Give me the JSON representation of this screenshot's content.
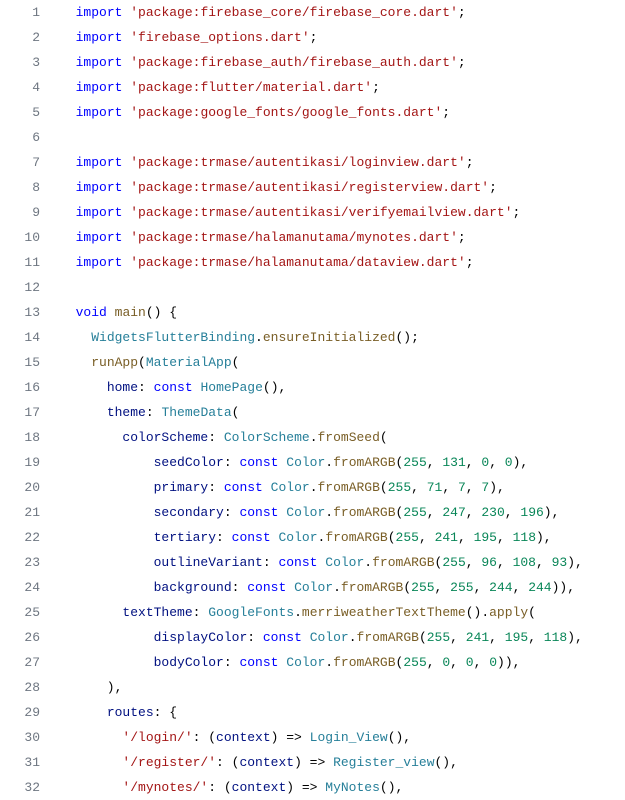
{
  "lines": [
    {
      "n": "1",
      "indent": 1,
      "type": "import",
      "pkg": "'package:firebase_core/firebase_core.dart'"
    },
    {
      "n": "2",
      "indent": 1,
      "type": "import",
      "pkg": "'firebase_options.dart'"
    },
    {
      "n": "3",
      "indent": 1,
      "type": "import",
      "pkg": "'package:firebase_auth/firebase_auth.dart'"
    },
    {
      "n": "4",
      "indent": 1,
      "type": "import",
      "pkg": "'package:flutter/material.dart'"
    },
    {
      "n": "5",
      "indent": 1,
      "type": "import",
      "pkg": "'package:google_fonts/google_fonts.dart'"
    },
    {
      "n": "6",
      "indent": 0,
      "type": "blank"
    },
    {
      "n": "7",
      "indent": 1,
      "type": "import",
      "pkg": "'package:trmase/autentikasi/loginview.dart'"
    },
    {
      "n": "8",
      "indent": 1,
      "type": "import",
      "pkg": "'package:trmase/autentikasi/registerview.dart'"
    },
    {
      "n": "9",
      "indent": 1,
      "type": "import",
      "pkg": "'package:trmase/autentikasi/verifyemailview.dart'"
    },
    {
      "n": "10",
      "indent": 1,
      "type": "import",
      "pkg": "'package:trmase/halamanutama/mynotes.dart'"
    },
    {
      "n": "11",
      "indent": 1,
      "type": "import",
      "pkg": "'package:trmase/halamanutama/dataview.dart'"
    },
    {
      "n": "12",
      "indent": 0,
      "type": "blank"
    },
    {
      "n": "13",
      "indent": 1,
      "type": "raw",
      "html": "<span class=\"kw\">void</span> <span class=\"fn\">main</span>() {"
    },
    {
      "n": "14",
      "indent": 2,
      "type": "raw",
      "html": "<span class=\"cls\">WidgetsFlutterBinding</span>.<span class=\"fn\">ensureInitialized</span>();"
    },
    {
      "n": "15",
      "indent": 2,
      "type": "raw",
      "html": "<span class=\"fn\">runApp</span>(<span class=\"cls\">MaterialApp</span>("
    },
    {
      "n": "16",
      "indent": 3,
      "type": "raw",
      "html": "<span class=\"prop\">home</span>: <span class=\"kw\">const</span> <span class=\"cls\">HomePage</span>(),"
    },
    {
      "n": "17",
      "indent": 3,
      "type": "raw",
      "html": "<span class=\"prop\">theme</span>: <span class=\"cls\">ThemeData</span>("
    },
    {
      "n": "18",
      "indent": 4,
      "type": "raw",
      "html": "<span class=\"prop\">colorScheme</span>: <span class=\"cls\">ColorScheme</span>.<span class=\"fn\">fromSeed</span>("
    },
    {
      "n": "19",
      "indent": 6,
      "type": "argb",
      "label": "seedColor",
      "a": "255",
      "r": "131",
      "g": "0",
      "b": "0",
      "tail": "),"
    },
    {
      "n": "20",
      "indent": 6,
      "type": "argb",
      "label": "primary",
      "a": "255",
      "r": "71",
      "g": "7",
      "b": "7",
      "tail": "),"
    },
    {
      "n": "21",
      "indent": 6,
      "type": "argb",
      "label": "secondary",
      "a": "255",
      "r": "247",
      "g": "230",
      "b": "196",
      "tail": "),"
    },
    {
      "n": "22",
      "indent": 6,
      "type": "argb",
      "label": "tertiary",
      "a": "255",
      "r": "241",
      "g": "195",
      "b": "118",
      "tail": "),"
    },
    {
      "n": "23",
      "indent": 6,
      "type": "argb",
      "label": "outlineVariant",
      "a": "255",
      "r": "96",
      "g": "108",
      "b": "93",
      "tail": "),"
    },
    {
      "n": "24",
      "indent": 6,
      "type": "argb",
      "label": "background",
      "a": "255",
      "r": "255",
      "g": "244",
      "b": "244",
      "tail": ")),"
    },
    {
      "n": "25",
      "indent": 4,
      "type": "raw",
      "html": "<span class=\"prop\">textTheme</span>: <span class=\"cls\">GoogleFonts</span>.<span class=\"fn\">merriweatherTextTheme</span>().<span class=\"fn\">apply</span>("
    },
    {
      "n": "26",
      "indent": 6,
      "type": "argb",
      "label": "displayColor",
      "a": "255",
      "r": "241",
      "g": "195",
      "b": "118",
      "tail": "),"
    },
    {
      "n": "27",
      "indent": 6,
      "type": "argb",
      "label": "bodyColor",
      "a": "255",
      "r": "0",
      "g": "0",
      "b": "0",
      "tail": ")),"
    },
    {
      "n": "28",
      "indent": 3,
      "type": "raw",
      "html": "),"
    },
    {
      "n": "29",
      "indent": 3,
      "type": "raw",
      "html": "<span class=\"prop\">routes</span>: {"
    },
    {
      "n": "30",
      "indent": 4,
      "type": "route",
      "key": "'/login/'",
      "cls": "Login_View"
    },
    {
      "n": "31",
      "indent": 4,
      "type": "route",
      "key": "'/register/'",
      "cls": "Register_view"
    },
    {
      "n": "32",
      "indent": 4,
      "type": "route",
      "key": "'/mynotes/'",
      "cls": "MyNotes"
    }
  ],
  "tokens": {
    "import": "import",
    "const": "const",
    "Color": "Color",
    "fromARGB": "fromARGB",
    "context": "context",
    "arrow": "=>"
  }
}
